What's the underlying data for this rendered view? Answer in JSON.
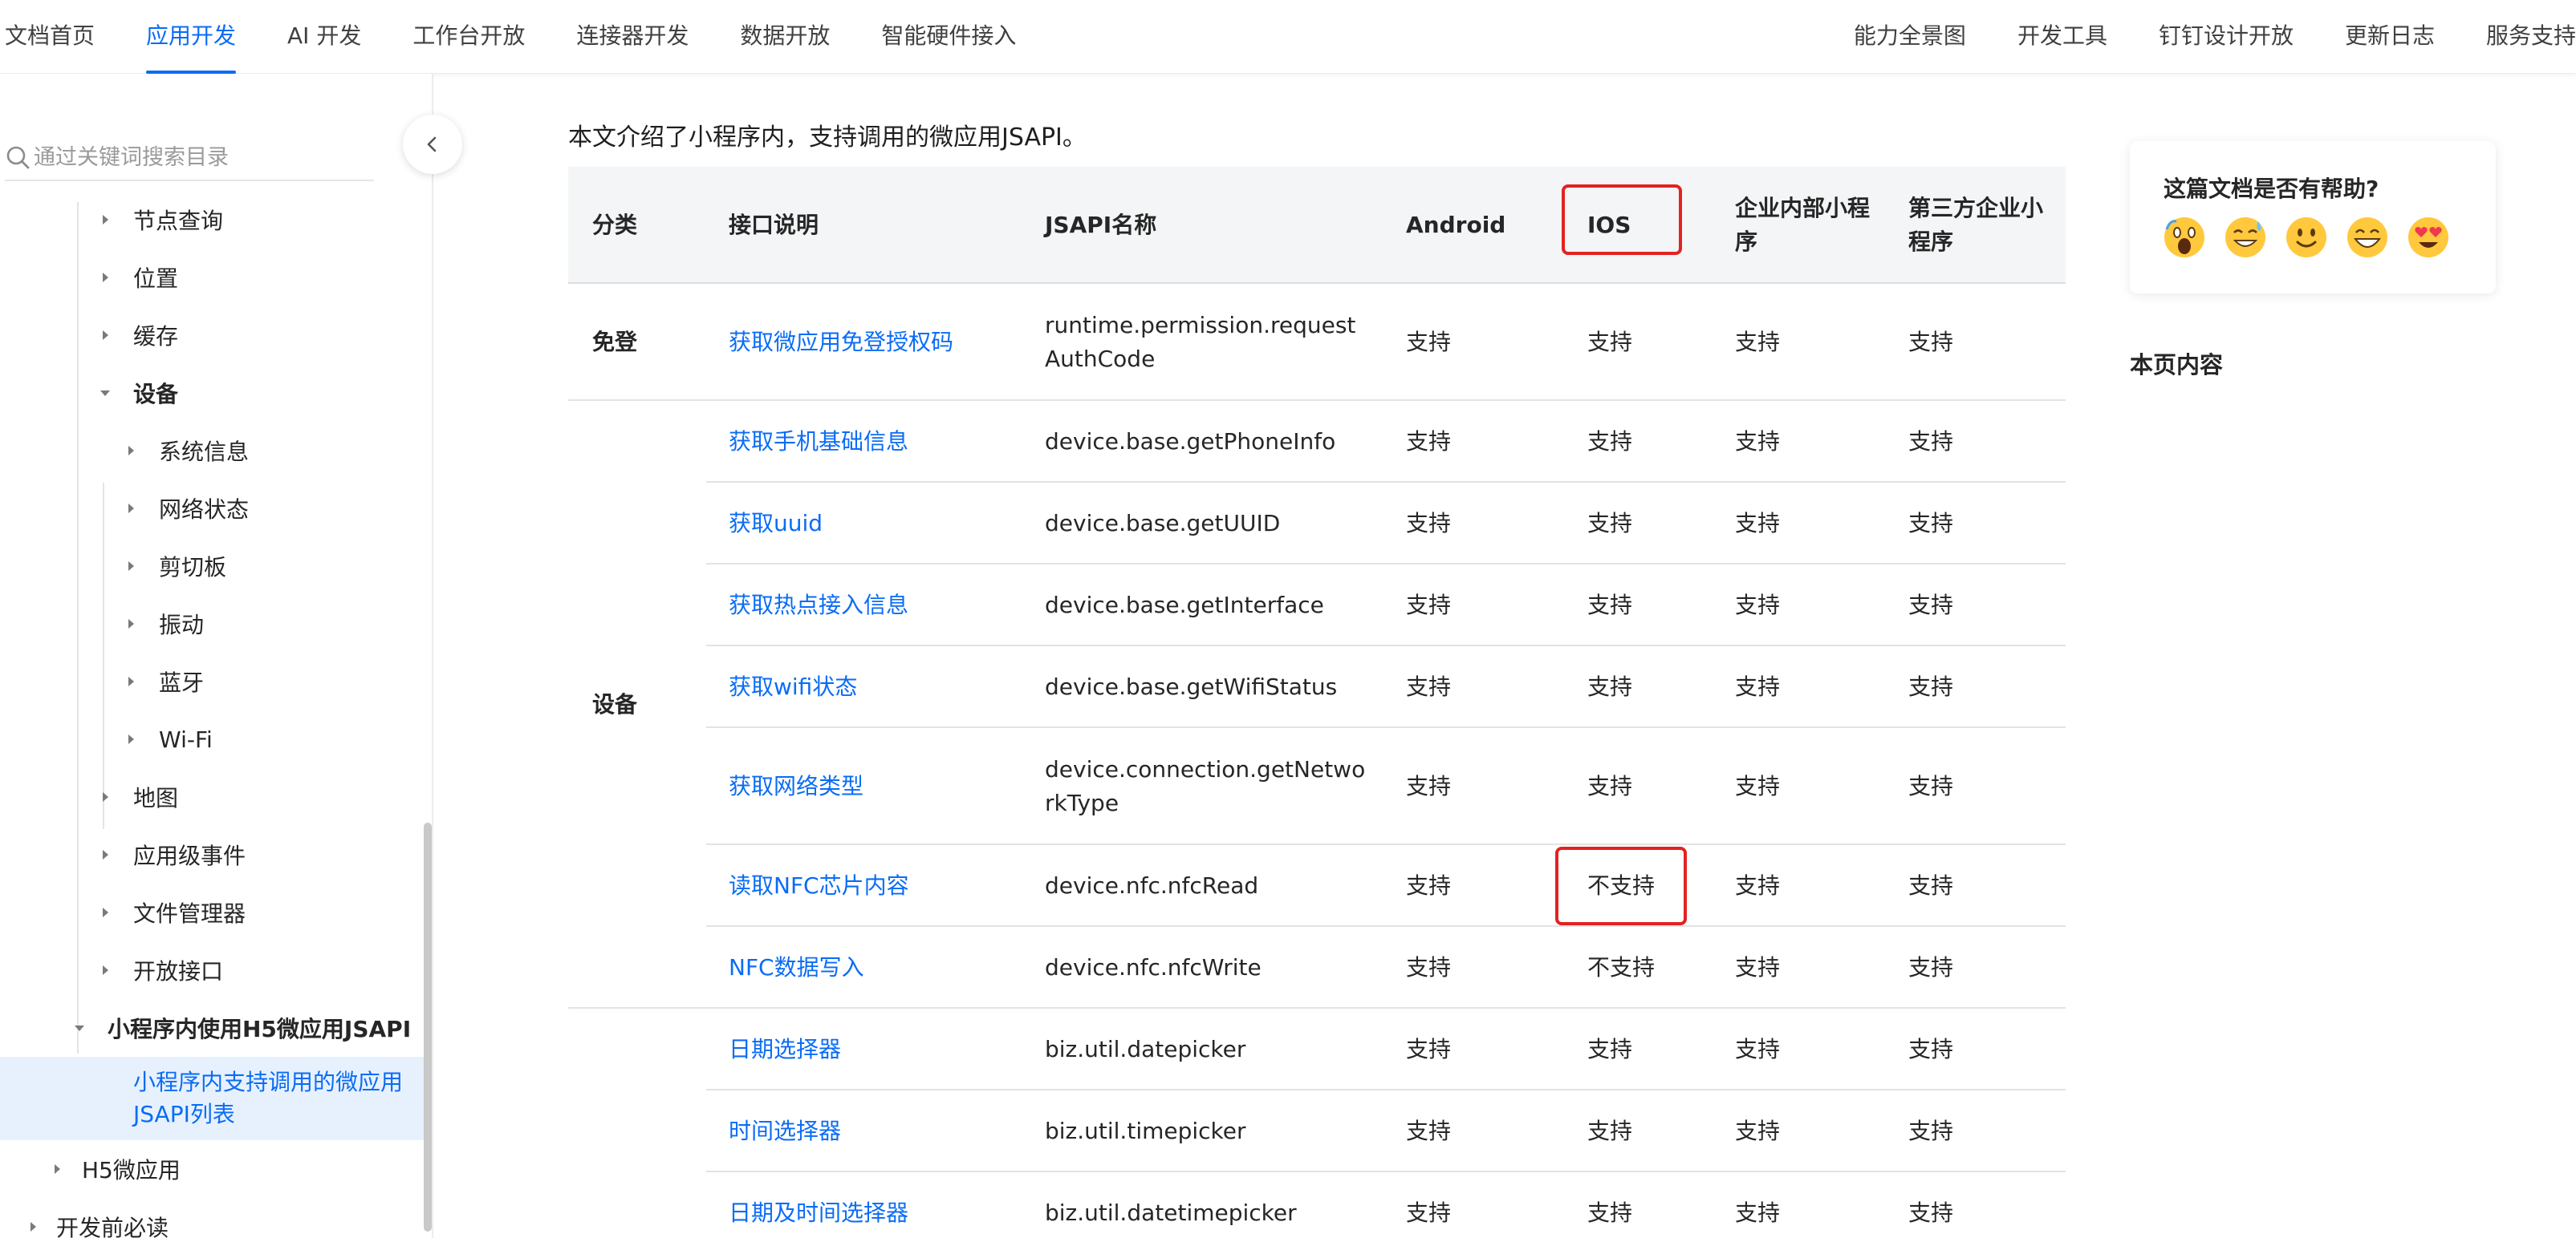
{
  "topnav": {
    "left": [
      "文档首页",
      "应用开发",
      "AI 开发",
      "工作台开放",
      "连接器开发",
      "数据开放",
      "智能硬件接入"
    ],
    "active_index": 1,
    "right": [
      "能力全景图",
      "开发工具",
      "钉钉设计开放",
      "更新日志",
      "服务支持"
    ]
  },
  "sidebar": {
    "search_placeholder": "通过关键词搜索目录",
    "tree": [
      {
        "label": "节点查询",
        "level": 1,
        "expanded": false
      },
      {
        "label": "位置",
        "level": 1,
        "expanded": false
      },
      {
        "label": "缓存",
        "level": 1,
        "expanded": false
      },
      {
        "label": "设备",
        "level": 1,
        "expanded": true,
        "bold": true
      },
      {
        "label": "系统信息",
        "level": 2,
        "expanded": false
      },
      {
        "label": "网络状态",
        "level": 2,
        "expanded": false
      },
      {
        "label": "剪切板",
        "level": 2,
        "expanded": false
      },
      {
        "label": "振动",
        "level": 2,
        "expanded": false
      },
      {
        "label": "蓝牙",
        "level": 2,
        "expanded": false
      },
      {
        "label": "Wi-Fi",
        "level": 2,
        "expanded": false
      },
      {
        "label": "地图",
        "level": 1,
        "expanded": false
      },
      {
        "label": "应用级事件",
        "level": 1,
        "expanded": false
      },
      {
        "label": "文件管理器",
        "level": 1,
        "expanded": false
      },
      {
        "label": "开放接口",
        "level": 1,
        "expanded": false
      },
      {
        "label": "小程序内使用H5微应用JSAPI",
        "level": 0,
        "expanded": true,
        "bold": true
      },
      {
        "label": "小程序内支持调用的微应用JSAPI列表",
        "level": 1,
        "selected": true
      },
      {
        "label": "H5微应用",
        "level": -1,
        "expanded": false
      },
      {
        "label": "开发前必读",
        "level": -2,
        "expanded": false
      }
    ]
  },
  "main": {
    "intro": "本文介绍了小程序内，支持调用的微应用JSAPI。",
    "headers": [
      "分类",
      "接口说明",
      "JSAPI名称",
      "Android",
      "IOS",
      "企业内部小程序",
      "第三方企业小程序"
    ],
    "categories": [
      {
        "label": "免登"
      },
      {
        "label": "设备"
      }
    ],
    "rows": [
      {
        "desc": "获取微应用免登授权码",
        "api": "runtime.permission.requestAuthCode",
        "android": "支持",
        "ios": "支持",
        "internal": "支持",
        "third": "支持"
      },
      {
        "desc": "获取手机基础信息",
        "api": "device.base.getPhoneInfo",
        "android": "支持",
        "ios": "支持",
        "internal": "支持",
        "third": "支持"
      },
      {
        "desc": "获取uuid",
        "api": "device.base.getUUID",
        "android": "支持",
        "ios": "支持",
        "internal": "支持",
        "third": "支持"
      },
      {
        "desc": "获取热点接入信息",
        "api": "device.base.getInterface",
        "android": "支持",
        "ios": "支持",
        "internal": "支持",
        "third": "支持"
      },
      {
        "desc": "获取wifi状态",
        "api": "device.base.getWifiStatus",
        "android": "支持",
        "ios": "支持",
        "internal": "支持",
        "third": "支持"
      },
      {
        "desc": "获取网络类型",
        "api": "device.connection.getNetworkType",
        "android": "支持",
        "ios": "支持",
        "internal": "支持",
        "third": "支持"
      },
      {
        "desc": "读取NFC芯片内容",
        "api": "device.nfc.nfcRead",
        "android": "支持",
        "ios": "不支持",
        "internal": "支持",
        "third": "支持"
      },
      {
        "desc": "NFC数据写入",
        "api": "device.nfc.nfcWrite",
        "android": "支持",
        "ios": "不支持",
        "internal": "支持",
        "third": "支持"
      },
      {
        "desc": "日期选择器",
        "api": "biz.util.datepicker",
        "android": "支持",
        "ios": "支持",
        "internal": "支持",
        "third": "支持"
      },
      {
        "desc": "时间选择器",
        "api": "biz.util.timepicker",
        "android": "支持",
        "ios": "支持",
        "internal": "支持",
        "third": "支持"
      },
      {
        "desc": "日期及时间选择器",
        "api": "biz.util.datetimepicker",
        "android": "支持",
        "ios": "支持",
        "internal": "支持",
        "third": "支持"
      }
    ]
  },
  "right_panel": {
    "feedback_title": "这篇文档是否有帮助?",
    "emojis": [
      "scream-emoji-icon",
      "sweat-smile-emoji-icon",
      "smile-emoji-icon",
      "grin-emoji-icon",
      "heart-eyes-emoji-icon"
    ],
    "toc_title": "本页内容"
  },
  "colors": {
    "accent": "#0a6cf5",
    "highlight": "#e32222",
    "selected_bg": "#e7f1fd"
  }
}
